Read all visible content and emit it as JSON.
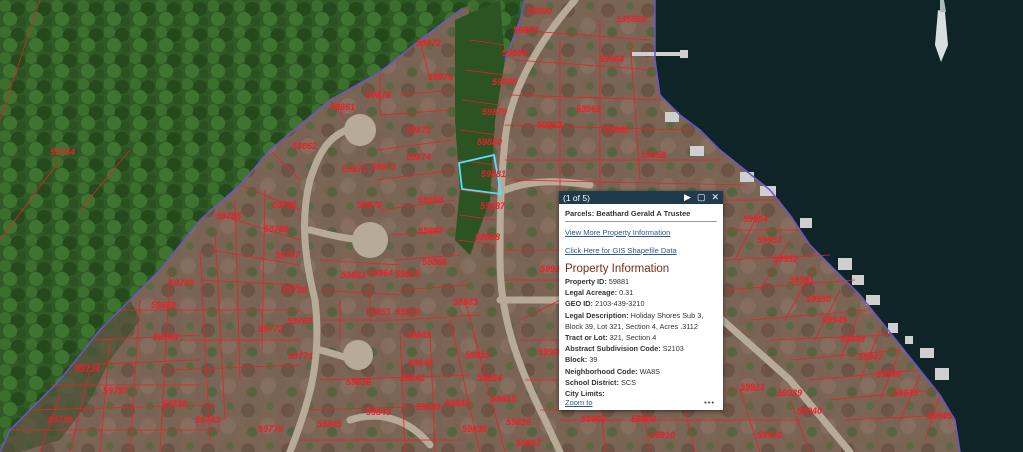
{
  "map": {
    "parcel_labels": [
      {
        "id": "59890"
      },
      {
        "id": "136869"
      },
      {
        "id": "59889"
      },
      {
        "id": "59872"
      },
      {
        "id": "59886"
      },
      {
        "id": "59964"
      },
      {
        "id": "59878"
      },
      {
        "id": "59876"
      },
      {
        "id": "59885"
      },
      {
        "id": "59861"
      },
      {
        "id": "59961"
      },
      {
        "id": "59879"
      },
      {
        "id": "59875"
      },
      {
        "id": "59963"
      },
      {
        "id": "59960"
      },
      {
        "id": "59862"
      },
      {
        "id": "59880"
      },
      {
        "id": "59958"
      },
      {
        "id": "59874"
      },
      {
        "id": "59873"
      },
      {
        "id": "59871"
      },
      {
        "id": "59881"
      },
      {
        "id": "59868"
      },
      {
        "id": "59870"
      },
      {
        "id": "59887"
      },
      {
        "id": "59785"
      },
      {
        "id": "59954"
      },
      {
        "id": "59786"
      },
      {
        "id": "59867"
      },
      {
        "id": "59888"
      },
      {
        "id": "59953"
      },
      {
        "id": "59787"
      },
      {
        "id": "59866"
      },
      {
        "id": "59952"
      },
      {
        "id": "59929"
      },
      {
        "id": "59863"
      },
      {
        "id": "59864"
      },
      {
        "id": "59865"
      },
      {
        "id": "59951"
      },
      {
        "id": "59788"
      },
      {
        "id": "59950"
      },
      {
        "id": "59883"
      },
      {
        "id": "59769"
      },
      {
        "id": "59851"
      },
      {
        "id": "59850"
      },
      {
        "id": "59949"
      },
      {
        "id": "59772"
      },
      {
        "id": "59849"
      },
      {
        "id": "59948"
      },
      {
        "id": "59771"
      },
      {
        "id": "59853"
      },
      {
        "id": "59909"
      },
      {
        "id": "59947"
      },
      {
        "id": "59848"
      },
      {
        "id": "59854"
      },
      {
        "id": "59946"
      },
      {
        "id": "59842"
      },
      {
        "id": "59836"
      },
      {
        "id": "59921"
      },
      {
        "id": "59939"
      },
      {
        "id": "59945"
      },
      {
        "id": "59855"
      },
      {
        "id": "59841"
      },
      {
        "id": "59840"
      },
      {
        "id": "59843"
      },
      {
        "id": "59940"
      },
      {
        "id": "59943"
      },
      {
        "id": "59845"
      },
      {
        "id": "59856"
      },
      {
        "id": "59902"
      },
      {
        "id": "59908"
      },
      {
        "id": "59775"
      },
      {
        "id": "59830"
      },
      {
        "id": "59910"
      },
      {
        "id": "59920"
      },
      {
        "id": "59857"
      },
      {
        "id": "59786"
      },
      {
        "id": "59789"
      },
      {
        "id": "59735"
      },
      {
        "id": "59797"
      },
      {
        "id": "59748"
      },
      {
        "id": "59734"
      },
      {
        "id": "59743"
      },
      {
        "id": "59738"
      },
      {
        "id": "59888"
      },
      {
        "id": "59764"
      }
    ],
    "colors": {
      "parcel_line": "#e8202a",
      "boundary": "#6a56c8",
      "selected": "#4fe3ff",
      "water": "#0f2426"
    }
  },
  "popup": {
    "counter": "(1 of 5)",
    "title": "Parcels: Beathard Gerald A Trustee",
    "link_more": "View More Property Information",
    "link_gis": "Click Here for GIS Shapefile Data",
    "heading": "Property Information",
    "fields": [
      {
        "label": "Property ID:",
        "value": "59881"
      },
      {
        "label": "Legal Acreage:",
        "value": "0.31"
      },
      {
        "label": "GEO ID:",
        "value": "2103-439-3210"
      },
      {
        "label": "Legal Description:",
        "value": "Holiday Shores Sub 3, Block 39, Lot 321, Section 4, Acres .3112"
      },
      {
        "label": "Tract or Lot:",
        "value": "321, Section 4"
      },
      {
        "label": "Abstract Subdivision Code:",
        "value": "S2103"
      },
      {
        "label": "Block:",
        "value": "39"
      },
      {
        "label": "Neighborhood Code:",
        "value": "WA8S"
      },
      {
        "label": "School District:",
        "value": "SCS"
      },
      {
        "label": "City Limits:",
        "value": ""
      }
    ],
    "zoom_label": "Zoom to",
    "more_label": "•••"
  }
}
